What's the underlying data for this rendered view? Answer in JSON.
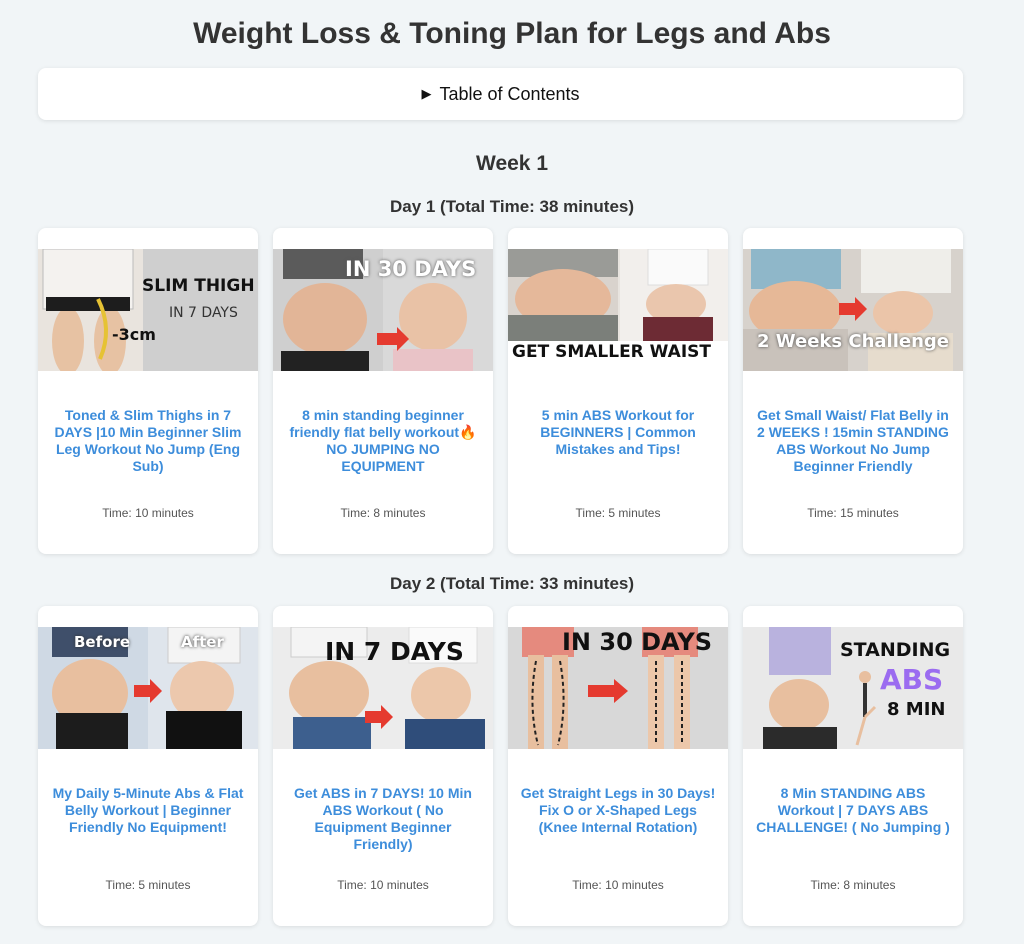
{
  "page": {
    "title": "Weight Loss & Toning Plan for Legs and Abs"
  },
  "toc": {
    "label": "Table of Contents",
    "icon": "triangle-right-icon"
  },
  "week": {
    "title": "Week 1"
  },
  "days": [
    {
      "title": "Day 1 (Total Time: 38 minutes)",
      "videos": [
        {
          "thumb_text": [
            "SLIM THIGH",
            "IN 7 DAYS",
            "-3cm"
          ],
          "title": "Toned & Slim Thighs in 7 DAYS |10 Min Beginner Slim Leg Workout No Jump (Eng Sub)",
          "time": "Time: 10 minutes"
        },
        {
          "thumb_text": [
            "IN 30 DAYS"
          ],
          "title": "8 min standing beginner friendly flat belly workout🔥 NO JUMPING NO EQUIPMENT",
          "time": "Time: 8 minutes"
        },
        {
          "thumb_text": [
            "GET SMALLER WAIST"
          ],
          "title": "5 min ABS Workout for BEGINNERS | Common Mistakes and Tips!",
          "time": "Time: 5 minutes"
        },
        {
          "thumb_text": [
            "2 Weeks Challenge"
          ],
          "title": "Get Small Waist/ Flat Belly in 2 WEEKS ! 15min STANDING ABS Workout No Jump Beginner Friendly",
          "time": "Time: 15 minutes"
        }
      ]
    },
    {
      "title": "Day 2 (Total Time: 33 minutes)",
      "videos": [
        {
          "thumb_text": [
            "Before",
            "After"
          ],
          "title": "My Daily 5-Minute Abs & Flat Belly Workout | Beginner Friendly No Equipment!",
          "time": "Time: 5 minutes"
        },
        {
          "thumb_text": [
            "IN 7 DAYS"
          ],
          "title": "Get ABS in 7 DAYS! 10 Min ABS Workout ( No Equipment Beginner Friendly)",
          "time": "Time: 10 minutes"
        },
        {
          "thumb_text": [
            "IN 30 DAYS"
          ],
          "title": "Get Straight Legs in 30 Days! Fix O or X-Shaped Legs (Knee Internal Rotation)",
          "time": "Time: 10 minutes"
        },
        {
          "thumb_text": [
            "STANDING",
            "ABS",
            "8 MIN"
          ],
          "title": "8 Min STANDING ABS Workout | 7 DAYS ABS CHALLENGE! ( No Jumping )",
          "time": "Time: 8 minutes"
        }
      ]
    }
  ],
  "colors": {
    "background": "#f1f5f7",
    "link": "#3d8ddb",
    "arrow": "#e53a2f",
    "abs_purple": "#9b6cf0"
  }
}
